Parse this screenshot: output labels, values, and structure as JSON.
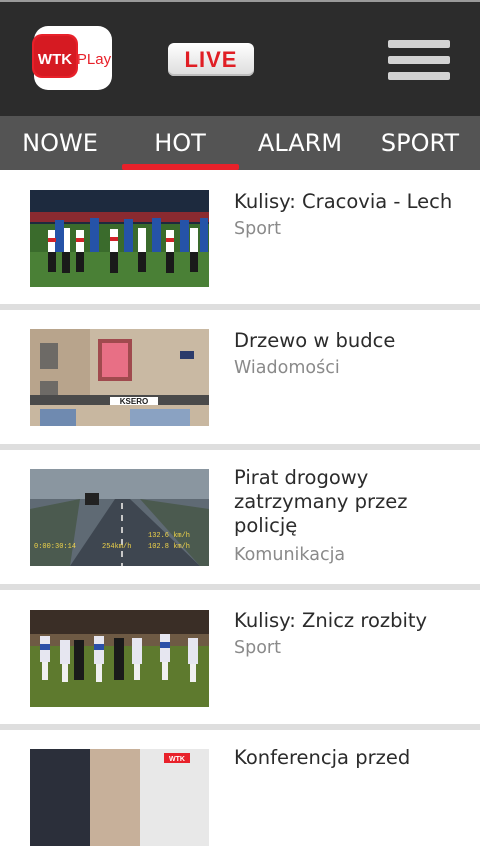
{
  "header": {
    "logo_text": "WTK PLay",
    "live_label": "LIVE"
  },
  "tabs": [
    {
      "label": "NOWE"
    },
    {
      "label": "HOT",
      "active": true
    },
    {
      "label": "ALARM"
    },
    {
      "label": "SPORT"
    }
  ],
  "colors": {
    "accent": "#e8212a",
    "topbar": "#2c2c2c",
    "tabbar": "#545454"
  },
  "videos": [
    {
      "title": "Kulisy: Cracovia - Lech",
      "category": "Sport"
    },
    {
      "title": "Drzewo w budce",
      "category": "Wiadomości",
      "thumb_text": "KSERO"
    },
    {
      "title": "Pirat drogowy zatrzymany przez policję",
      "category": "Komunikacja",
      "thumb_overlay": [
        "132.6 km/h",
        "0:00:30:14",
        "254km/h",
        "102.8 km/h"
      ]
    },
    {
      "title": "Kulisy: Znicz rozbity",
      "category": "Sport"
    },
    {
      "title": "Konferencja przed",
      "thumb_text": "WTK"
    }
  ]
}
